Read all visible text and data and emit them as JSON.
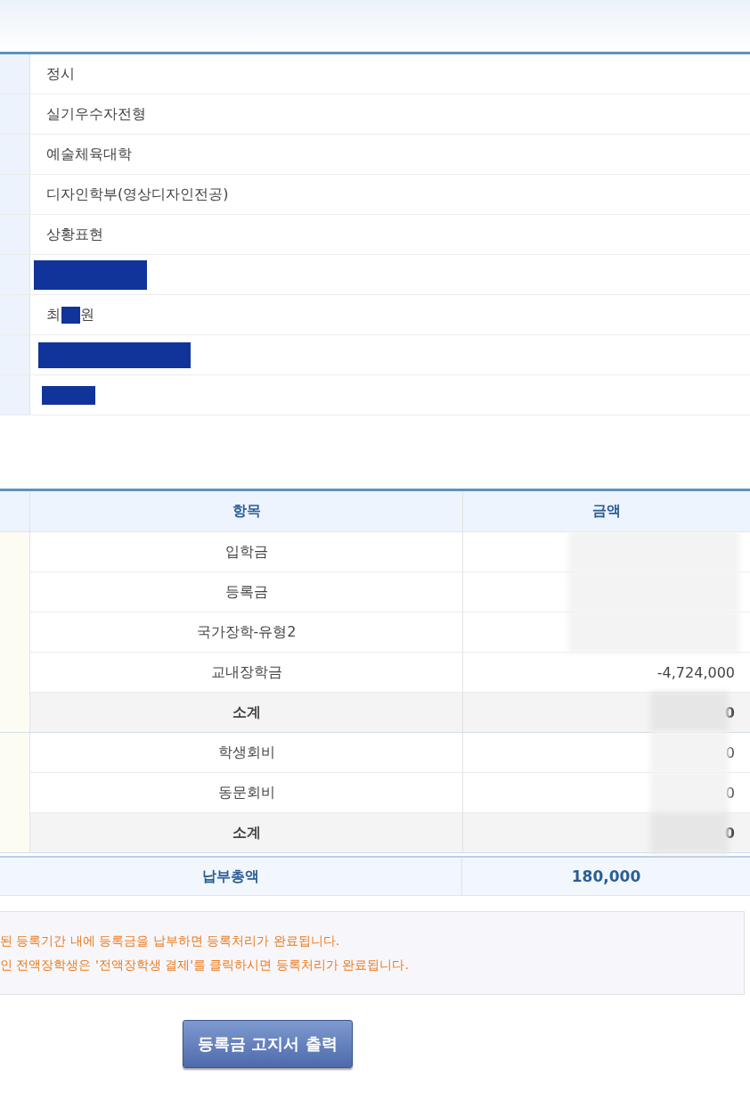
{
  "info_rows": [
    {
      "kind": "text",
      "value": "정시"
    },
    {
      "kind": "text",
      "value": "실기우수자전형"
    },
    {
      "kind": "text",
      "value": "예술체육대학"
    },
    {
      "kind": "text",
      "value": "디자인학부(영상디자인전공)"
    },
    {
      "kind": "text",
      "value": "상황표현"
    },
    {
      "kind": "redacted"
    },
    {
      "kind": "partly_redacted",
      "before": "최",
      "after": "원"
    },
    {
      "kind": "redacted"
    },
    {
      "kind": "redacted"
    }
  ],
  "fee_table": {
    "columns": [
      "항목",
      "금액"
    ],
    "groups": [
      {
        "rows": [
          {
            "kind": "item",
            "item": "입학금",
            "blurred": true
          },
          {
            "kind": "item",
            "item": "등록금",
            "blurred": true
          },
          {
            "kind": "item",
            "item": "국가장학-유형2",
            "blurred": true
          },
          {
            "kind": "item",
            "item": "교내장학금",
            "amount": "-4,724,000",
            "blurred": false
          },
          {
            "kind": "subtotal",
            "item": "소계",
            "amount": "0",
            "blurred": true
          }
        ]
      },
      {
        "rows": [
          {
            "kind": "item",
            "item": "학생회비",
            "amount": "0",
            "blurred": true
          },
          {
            "kind": "item",
            "item": "동문회비",
            "amount": "0",
            "blurred": true
          },
          {
            "kind": "subtotal",
            "item": "소계",
            "amount": "0",
            "blurred": true
          }
        ]
      }
    ],
    "total": {
      "label": "납부총액",
      "amount": "180,000"
    }
  },
  "notices": [
    "된 등록기간 내에 등록금을 납부하면 등록처리가 완료됩니다.",
    "인 전액장학생은 '전액장학생 결제'를 클릭하시면 등록처리가 완료됩니다."
  ],
  "print_button": "등록금 고지서 출력"
}
